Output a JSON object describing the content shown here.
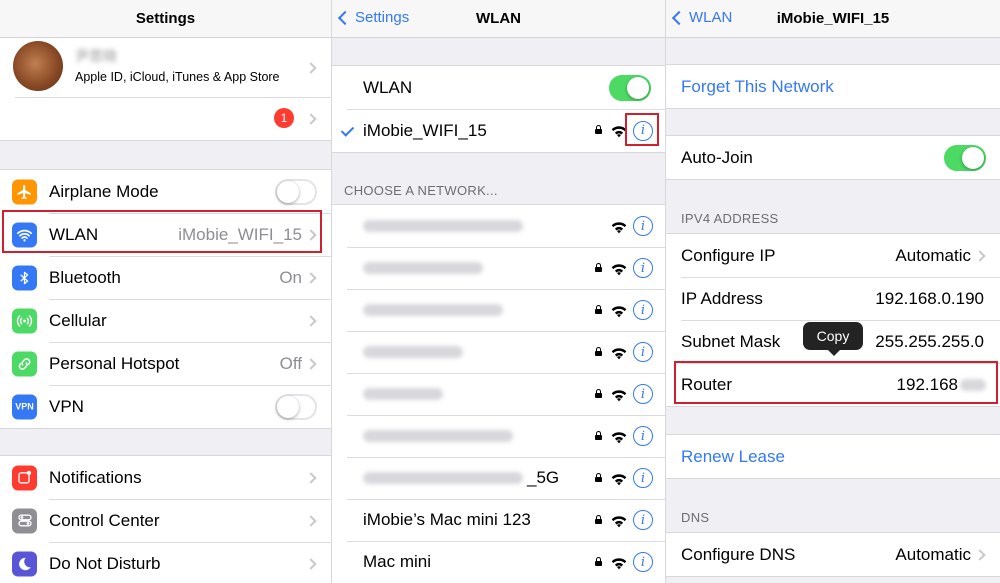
{
  "settings": {
    "title": "Settings",
    "profile": {
      "name": "尹恩晓",
      "subtitle": "Apple ID, iCloud, iTunes & App Store"
    },
    "badge": "1",
    "items": [
      {
        "label": "Airplane Mode",
        "value": "",
        "icon": "airplane-icon",
        "color": "#ff9500"
      },
      {
        "label": "WLAN",
        "value": "iMobie_WIFI_15",
        "icon": "wifi-icon",
        "color": "#3478f6"
      },
      {
        "label": "Bluetooth",
        "value": "On",
        "icon": "bluetooth-icon",
        "color": "#3478f6"
      },
      {
        "label": "Cellular",
        "value": "",
        "icon": "cellular-icon",
        "color": "#4cd964"
      },
      {
        "label": "Personal Hotspot",
        "value": "Off",
        "icon": "hotspot-icon",
        "color": "#4cd964"
      },
      {
        "label": "VPN",
        "value": "",
        "icon": "vpn-icon",
        "color": "#3478f6"
      }
    ],
    "items2": [
      {
        "label": "Notifications",
        "icon": "notifications-icon",
        "color": "#ff3b30"
      },
      {
        "label": "Control Center",
        "icon": "control-center-icon",
        "color": "#8e8e93"
      },
      {
        "label": "Do Not Disturb",
        "icon": "moon-icon",
        "color": "#5856d6"
      }
    ]
  },
  "wlan": {
    "back": "Settings",
    "title": "WLAN",
    "toggle_label": "WLAN",
    "connected": "iMobie_WIFI_15",
    "section": "CHOOSE A NETWORK...",
    "networks": [
      "",
      "",
      "",
      "",
      "",
      "",
      "_5G",
      "iMobie’s Mac mini 123",
      "Mac mini"
    ],
    "info_glyph": "i"
  },
  "detail": {
    "back": "WLAN",
    "title": "iMobie_WIFI_15",
    "forget": "Forget This Network",
    "autojoin": "Auto-Join",
    "ipv4_header": "IPV4 ADDRESS",
    "configure_ip": {
      "label": "Configure IP",
      "value": "Automatic"
    },
    "ip_address": {
      "label": "IP Address",
      "value": "192.168.0.190"
    },
    "subnet": {
      "label": "Subnet Mask",
      "value": "255.255.255.0"
    },
    "router": {
      "label": "Router",
      "value": "192.168"
    },
    "copy_tooltip": "Copy",
    "renew": "Renew Lease",
    "dns_header": "DNS",
    "configure_dns": {
      "label": "Configure DNS",
      "value": "Automatic"
    }
  },
  "colors": {
    "accent": "#3478f6",
    "toggle_on": "#4cd964",
    "highlight": "#d0202e"
  }
}
